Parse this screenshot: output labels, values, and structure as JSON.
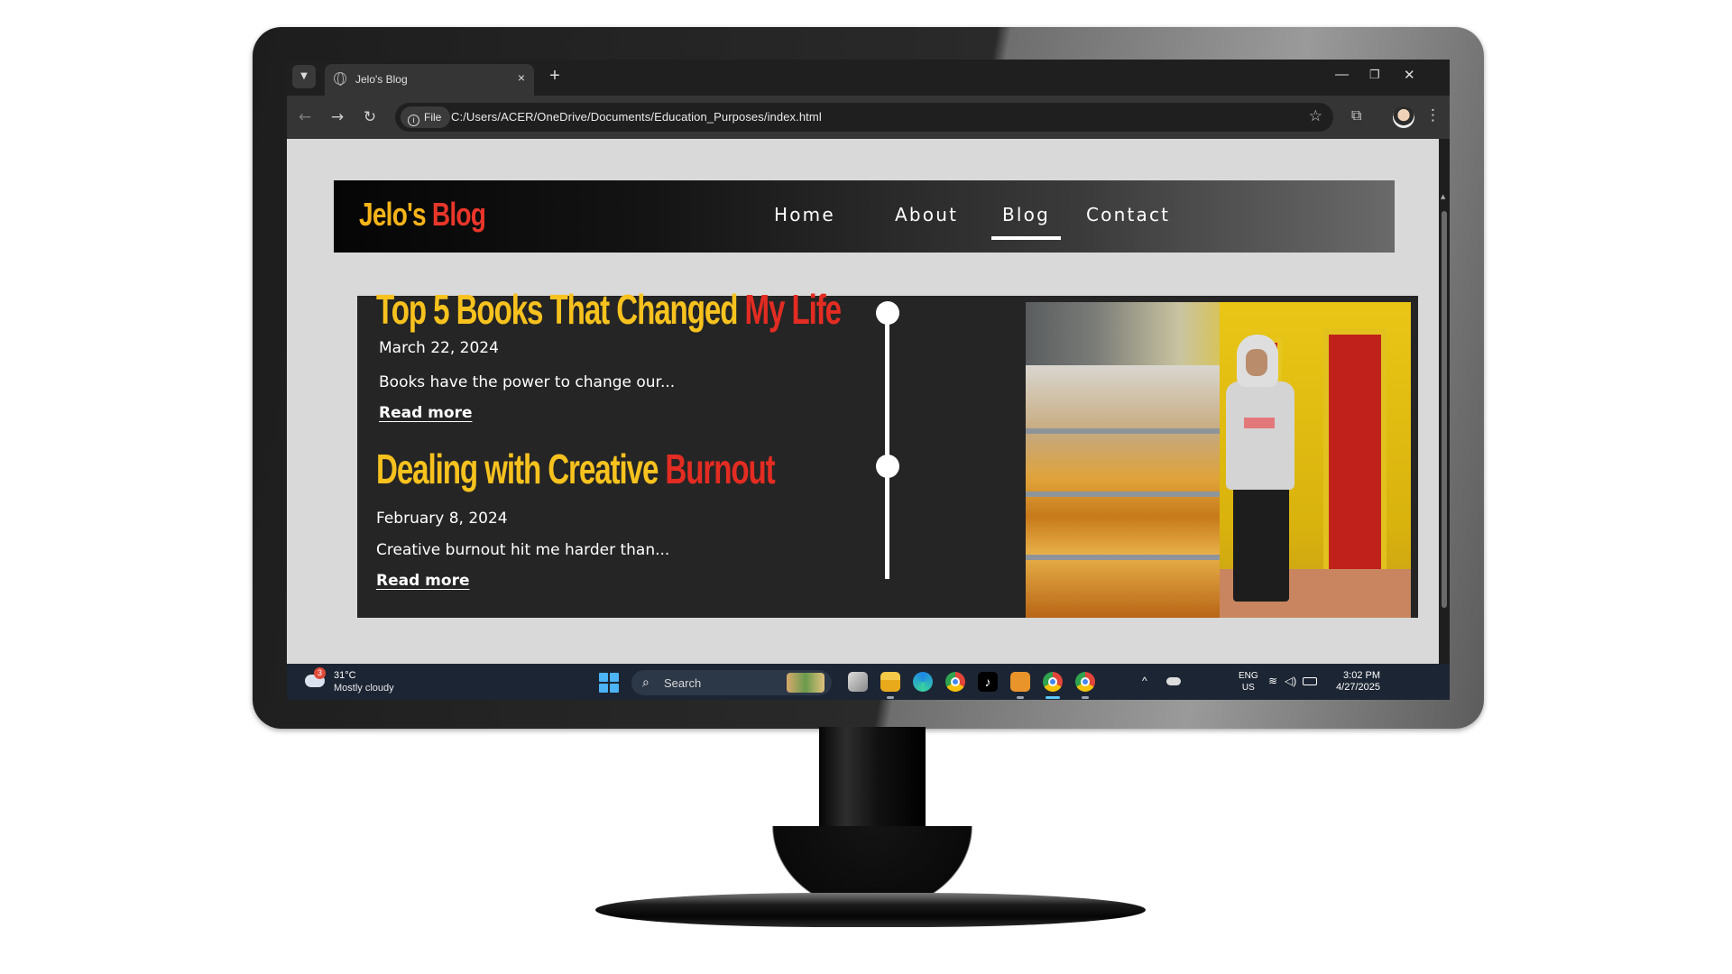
{
  "browser": {
    "tab_title": "Jelo's Blog",
    "tab_close": "×",
    "new_tab": "+",
    "window_minimize": "—",
    "window_restore": "❐",
    "window_close": "✕",
    "url_chip": "File",
    "url": "C:/Users/ACER/OneDrive/Documents/Education_Purposes/index.html"
  },
  "site": {
    "logo_part1": "Jelo's ",
    "logo_part2": "Blog",
    "nav": [
      {
        "label": "Home",
        "active": false
      },
      {
        "label": "About",
        "active": false
      },
      {
        "label": "Blog",
        "active": true
      },
      {
        "label": "Contact",
        "active": false
      }
    ]
  },
  "posts": [
    {
      "title_part1": "Top 5 Books That Changed ",
      "title_part2": "My Life",
      "date": "March 22, 2024",
      "excerpt": "Books have the power to change our...",
      "read_more": "Read more"
    },
    {
      "title_part1": "Dealing with Creative ",
      "title_part2": "Burnout",
      "date": "February 8, 2024",
      "excerpt": "Creative burnout hit me harder than...",
      "read_more": "Read more"
    }
  ],
  "colors": {
    "logo_yellow": "#f6b419",
    "logo_red": "#e9362a",
    "panel_bg": "#252525",
    "page_bg": "#d9d9d9"
  },
  "taskbar": {
    "weather_badge": "3",
    "weather_temp": "31°C",
    "weather_desc": "Mostly cloudy",
    "search_label": "Search",
    "tray_lang_1": "ENG",
    "tray_lang_2": "US",
    "time": "3:02 PM",
    "date": "4/27/2025"
  },
  "icons": {
    "tab_list": "chevron-down-icon",
    "back": "arrow-left-icon",
    "forward": "arrow-right-icon",
    "reload": "reload-icon",
    "bookmark": "star-icon",
    "extensions": "puzzle-icon",
    "menu": "kebab-icon"
  }
}
